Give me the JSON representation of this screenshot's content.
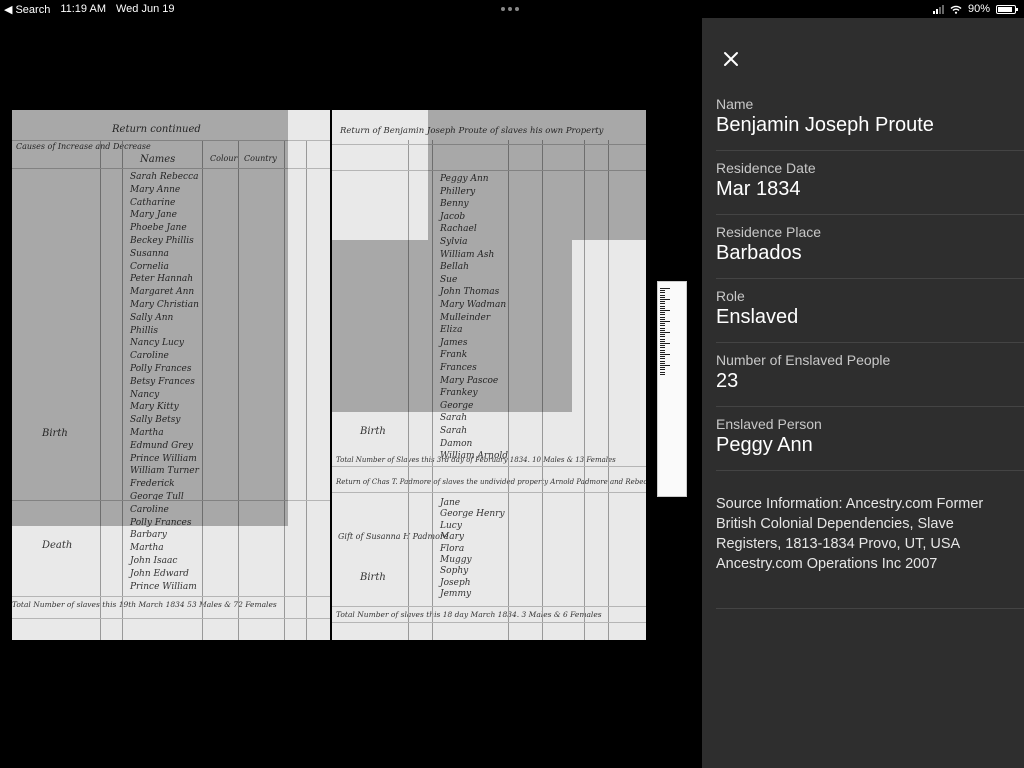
{
  "status_bar": {
    "back_label": "Search",
    "time": "11:19 AM",
    "date": "Wed Jun 19",
    "battery": "90%",
    "battery_level": 0.9
  },
  "panel": {
    "fields": [
      {
        "label": "Name",
        "value": "Benjamin Joseph Proute"
      },
      {
        "label": "Residence Date",
        "value": "Mar 1834"
      },
      {
        "label": "Residence Place",
        "value": "Barbados"
      },
      {
        "label": "Role",
        "value": "Enslaved"
      },
      {
        "label": "Number of Enslaved People",
        "value": "23"
      },
      {
        "label": "Enslaved Person",
        "value": "Peggy Ann"
      }
    ],
    "source": "Source Information: Ancestry.com Former British Colonial Dependencies, Slave Registers, 1813-1834 Provo, UT, USA Ancestry.com Operations Inc 2007"
  },
  "document": {
    "left_heading": "Return continued",
    "left_col_causes": "Causes of Increase and Decrease",
    "left_col_names": "Names",
    "left_col_colour": "Colour",
    "left_col_country": "Country",
    "left_names": [
      "Sarah Rebecca",
      "Mary Anne",
      "Catharine",
      "Mary Jane",
      "Phoebe Jane",
      "Beckey Phillis",
      "Susanna",
      "Cornelia",
      "Peter Hannah",
      "Margaret Ann",
      "Mary Christian",
      "Sally Ann",
      "Phillis",
      "Nancy Lucy",
      "Caroline",
      "Polly Frances",
      "Betsy Frances",
      "Nancy",
      "Mary Kitty",
      "Sally Betsy",
      "Martha",
      "Edmund Grey",
      "Prince William",
      "William Turner",
      "Frederick",
      "George Tull",
      "Caroline",
      "Polly Frances",
      "Barbary",
      "Martha",
      "John Isaac",
      "John Edward",
      "Prince William"
    ],
    "left_birth": "Birth",
    "left_death": "Death",
    "left_total": "Total Number of slaves this 19th March 1834 53 Males & 72 Females",
    "right_heading": "Return of Benjamin Joseph Proute of slaves his own Property",
    "right_names": [
      "Peggy Ann",
      "Phillery",
      "Benny",
      "Jacob",
      "Rachael",
      "Sylvia",
      "William Ash",
      "Bellah",
      "Sue",
      "John Thomas",
      "Mary Wadman",
      "Mulleinder",
      "Eliza",
      "James",
      "Frank",
      "Frances",
      "Mary Pascoe",
      "Frankey",
      "George",
      "Sarah",
      "Sarah",
      "Damon",
      "William Arnold"
    ],
    "right_birth": "Birth",
    "right_total1": "Total Number of Slaves this 3rd day of February 1834. 10 Males & 13 Females",
    "right_heading2": "Return of Chas T. Padmore of slaves the undivided property Arnold Padmore and Rebecca Padmore deceased",
    "right_names2": [
      "Jane",
      "George Henry",
      "Lucy",
      "Mary",
      "Flora",
      "Muggy",
      "Sophy",
      "Joseph",
      "Jemmy"
    ],
    "right_gift": "Gift of Susanna H Padmore",
    "right_birth2": "Birth",
    "right_total2": "Total Number of slaves this 18 day March 1834. 3 Males & 6 Females"
  }
}
